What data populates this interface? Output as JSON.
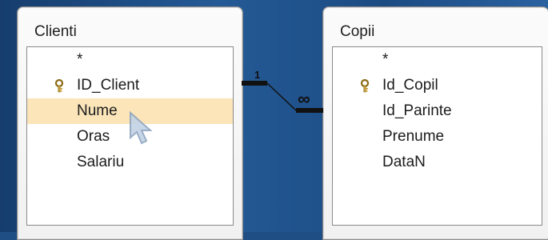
{
  "relationship": {
    "left_table": {
      "title": "Clienti",
      "fields": [
        "*",
        "ID_Client",
        "Nume",
        "Oras",
        "Salariu"
      ],
      "primary_key": "ID_Client",
      "highlighted": "Nume"
    },
    "right_table": {
      "title": "Copii",
      "fields": [
        "*",
        "Id_Copil",
        "Id_Parinte",
        "Prenume",
        "DataN"
      ],
      "primary_key": "Id_Copil"
    },
    "link": {
      "left_label": "1",
      "right_label": "∞"
    }
  },
  "colors": {
    "background": "#1f4e85",
    "highlight": "#fbe5b9",
    "key_icon": "#c8a03a"
  },
  "icons": {
    "key": "key-icon",
    "cursor": "pointer-cursor-icon"
  }
}
